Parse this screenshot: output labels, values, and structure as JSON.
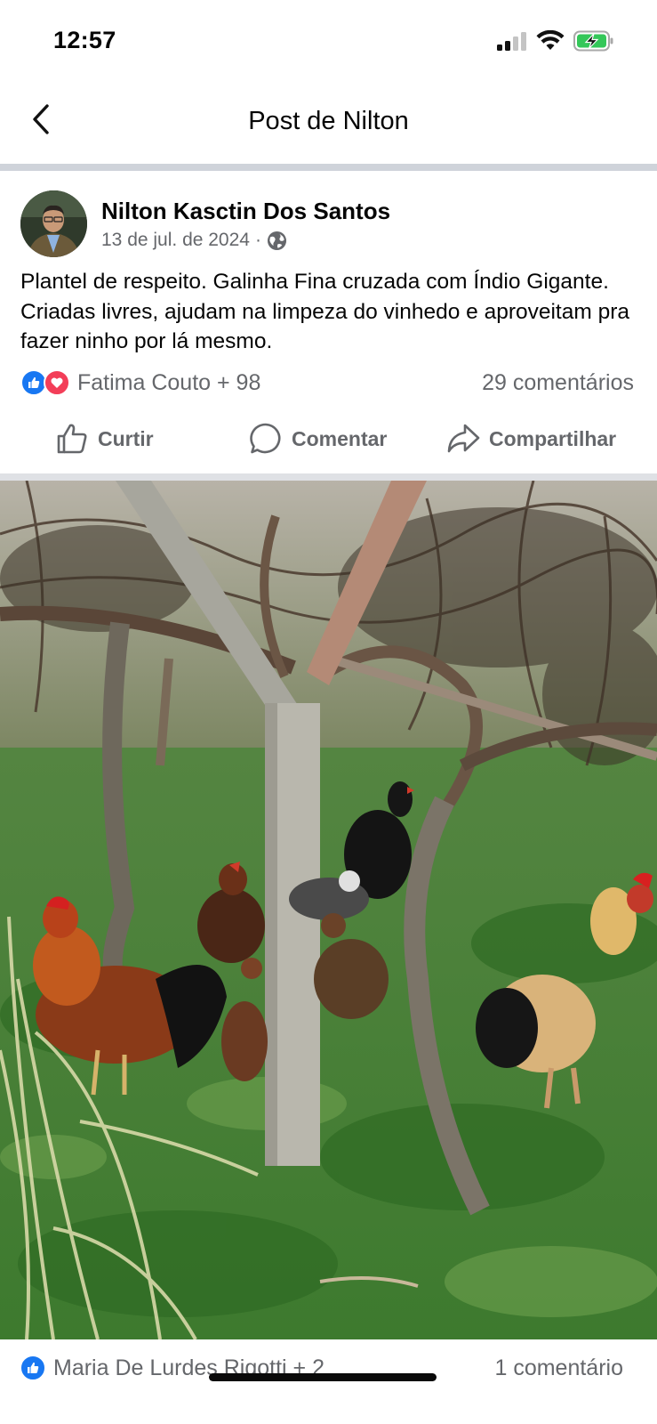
{
  "status_bar": {
    "time": "12:57",
    "icons": [
      "cellular-signal-icon",
      "wifi-icon",
      "battery-charging-icon"
    ],
    "battery_color": "#34c759"
  },
  "nav": {
    "title": "Post de Nilton",
    "back_icon": "chevron-left-icon"
  },
  "post": {
    "author": "Nilton Kasctin Dos Santos",
    "date": "13 de jul. de 2024",
    "separator": "·",
    "privacy_icon": "globe-icon",
    "text": "Plantel de respeito. Galinha Fina cruzada com Índio Gigante. Criadas livres, ajudam na limpeza do vinhedo e aproveitam pra fazer ninho por lá mesmo.",
    "reactions": {
      "icons": [
        "like-icon",
        "love-icon"
      ],
      "names": "Fatima Couto + 98",
      "comments": "29 comentários"
    },
    "actions": [
      {
        "label": "Curtir",
        "icon": "thumbs-up-icon"
      },
      {
        "label": "Comentar",
        "icon": "comment-bubble-icon"
      },
      {
        "label": "Compartilhar",
        "icon": "share-arrow-icon"
      }
    ],
    "photo_icon": "photo-chickens-vineyard"
  },
  "photo_reactions": {
    "icon": "like-icon",
    "names": "Maria De Lurdes Rigotti + 2",
    "comments": "1 comentário"
  },
  "colors": {
    "like_blue": "#1877f2",
    "love_red": "#f33e58",
    "secondary_text": "#65676b"
  }
}
